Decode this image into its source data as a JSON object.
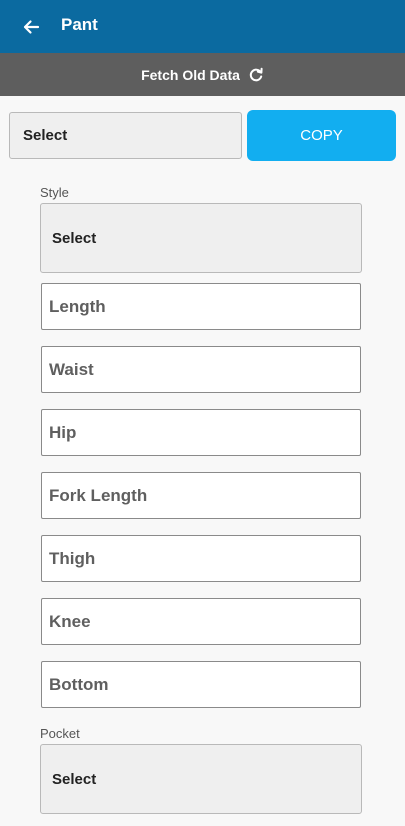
{
  "appbar": {
    "title": "Pant",
    "back_icon": "arrow-left-icon"
  },
  "fetch": {
    "label": "Fetch Old Data",
    "icon": "refresh-icon"
  },
  "copy_row": {
    "select_value": "Select",
    "copy_label": "COPY"
  },
  "style": {
    "label": "Style",
    "value": "Select"
  },
  "fields": [
    {
      "placeholder": "Length"
    },
    {
      "placeholder": "Waist"
    },
    {
      "placeholder": "Hip"
    },
    {
      "placeholder": "Fork Length"
    },
    {
      "placeholder": "Thigh"
    },
    {
      "placeholder": "Knee"
    },
    {
      "placeholder": "Bottom"
    }
  ],
  "pocket": {
    "label": "Pocket",
    "value": "Select"
  },
  "colors": {
    "appbar": "#0b6aa0",
    "fetchbar": "#5e5e5e",
    "accent": "#12aef0",
    "background": "#f8f8f8"
  }
}
